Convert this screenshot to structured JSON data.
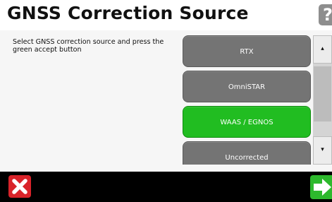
{
  "header": {
    "title": "GNSS Correction Source",
    "help_label": "?"
  },
  "instruction": "Select GNSS correction source and press the green accept button",
  "options": [
    {
      "label": "RTX",
      "selected": false
    },
    {
      "label": "OmniSTAR",
      "selected": false
    },
    {
      "label": "WAAS / EGNOS",
      "selected": true
    },
    {
      "label": "Uncorrected",
      "selected": false
    }
  ],
  "scroll": {
    "up_glyph": "▴",
    "down_glyph": "▾"
  },
  "footer": {
    "cancel_icon": "x-icon",
    "accept_icon": "arrow-right-icon"
  },
  "colors": {
    "option_default": "#747474",
    "option_selected": "#21bd21",
    "cancel": "#d9232a",
    "accept": "#2db92d",
    "footer_bg": "#000000"
  }
}
